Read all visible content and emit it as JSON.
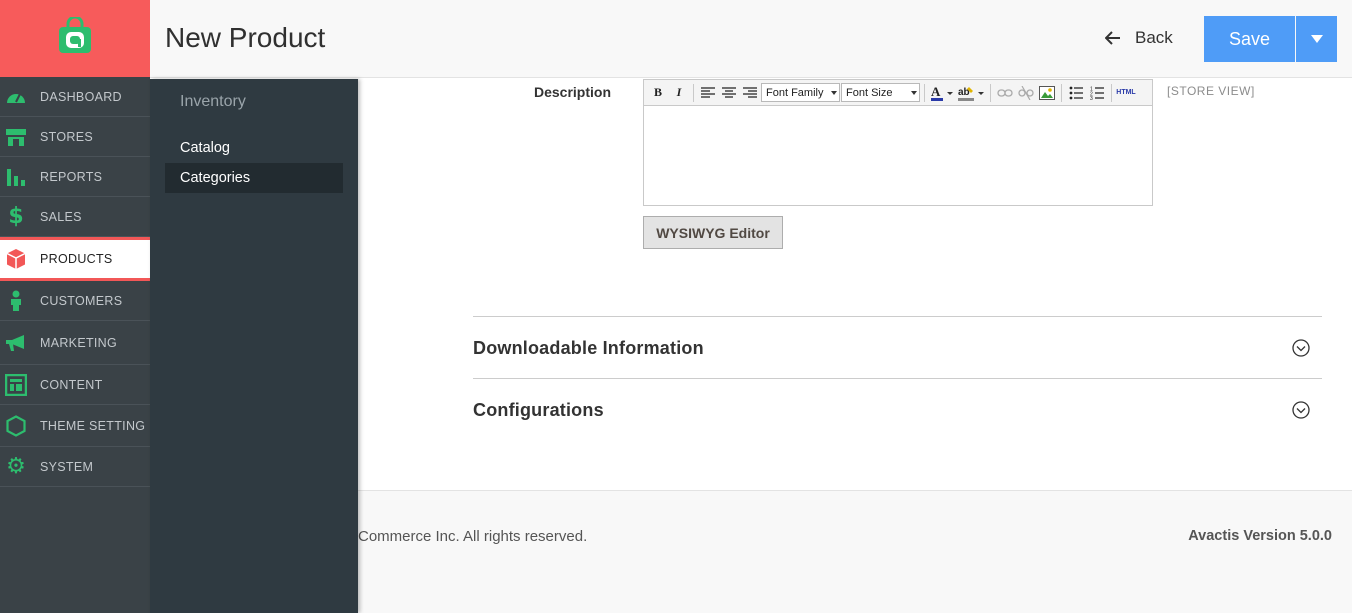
{
  "app": {
    "brand_color": "#f75b5b",
    "accent_color": "#4f9cf7",
    "icon_color": "#2dbd6e"
  },
  "sidebar": {
    "logo_icon": "shopping-bag-icon",
    "items": [
      {
        "label": "DASHBOARD",
        "icon": "dashboard-gauge-icon"
      },
      {
        "label": "STORES",
        "icon": "store-icon"
      },
      {
        "label": "REPORTS",
        "icon": "bar-chart-icon"
      },
      {
        "label": "SALES",
        "icon": "dollar-icon"
      },
      {
        "label": "PRODUCTS",
        "icon": "cube-icon",
        "active": true
      },
      {
        "label": "CUSTOMERS",
        "icon": "person-icon"
      },
      {
        "label": "MARKETING",
        "icon": "megaphone-icon"
      },
      {
        "label": "CONTENT",
        "icon": "layout-icon"
      },
      {
        "label": "THEME SETTING",
        "icon": "hexagon-icon"
      },
      {
        "label": "SYSTEM",
        "icon": "gear-icon"
      }
    ]
  },
  "submenu": {
    "title": "Inventory",
    "items": [
      {
        "label": "Catalog"
      },
      {
        "label": "Categories",
        "selected": true
      }
    ]
  },
  "header": {
    "title": "New Product",
    "back_label": "Back",
    "save_label": "Save"
  },
  "form": {
    "description_label": "Description",
    "toolbar": {
      "font_family": "Font Family",
      "font_size": "Font Size",
      "html_label": "HTML"
    },
    "store_view": "[STORE VIEW]",
    "wysiwyg_label": "WYSIWYG Editor"
  },
  "sections": [
    {
      "title": "Downloadable Information"
    },
    {
      "title": "Configurations"
    }
  ],
  "footer": {
    "copyright": "Commerce Inc. All rights reserved.",
    "version": "Avactis Version 5.0.0"
  }
}
